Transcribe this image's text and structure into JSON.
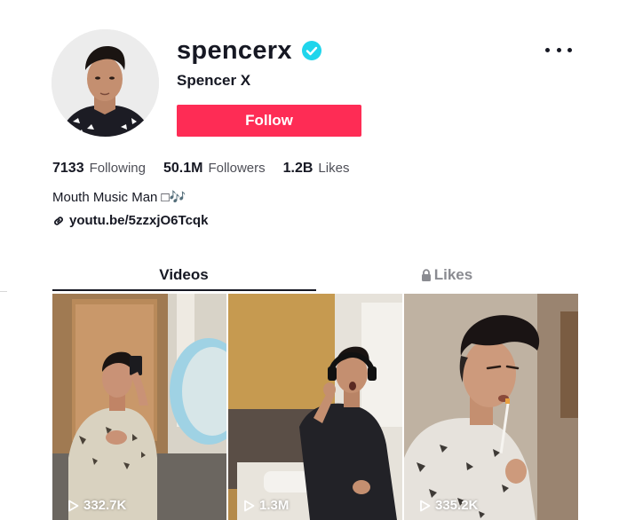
{
  "profile": {
    "username": "spencerx",
    "nickname": "Spencer X",
    "follow_label": "Follow",
    "bio": "Mouth Music Man □🎶",
    "link": "youtu.be/5zzxjO6Tcqk"
  },
  "stats": {
    "following": {
      "value": "7133",
      "label": "Following"
    },
    "followers": {
      "value": "50.1M",
      "label": "Followers"
    },
    "likes": {
      "value": "1.2B",
      "label": "Likes"
    }
  },
  "tabs": {
    "videos": "Videos",
    "likes": "Likes"
  },
  "videos": [
    {
      "views": "332.7K"
    },
    {
      "views": "1.3M"
    },
    {
      "views": "335.2K"
    }
  ],
  "colors": {
    "accent": "#fe2c55",
    "verified": "#20d5ec",
    "text": "#161823",
    "muted": "#8a8b91"
  },
  "icons": {
    "verified": "verified-badge-icon",
    "more": "more-options-icon",
    "link": "link-icon",
    "lock": "lock-icon",
    "play": "play-icon"
  }
}
